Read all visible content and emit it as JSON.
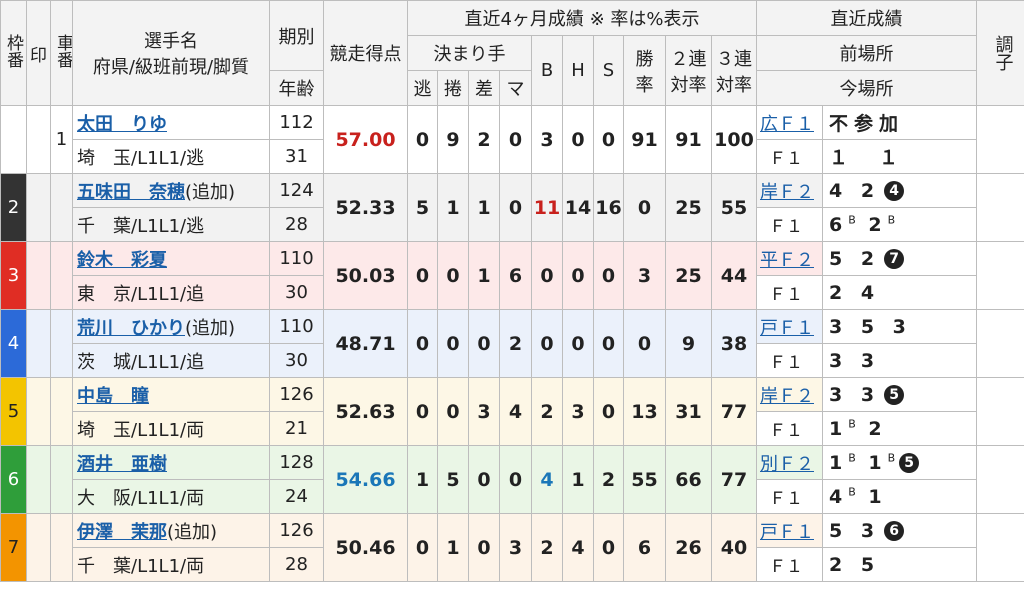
{
  "header": {
    "waku": "枠番",
    "in": "印",
    "sha": "車番",
    "name_top": "選手名",
    "name_bottom": "府県/級班前現/脚質",
    "kibetsu": "期別",
    "nenrei": "年齢",
    "score": "競走得点",
    "recent_group": "直近4ヶ月成績 ※ 率は%表示",
    "kimarite": "決まり手",
    "nige": "逃",
    "makuri": "捲",
    "sashi": "差",
    "ma": "マ",
    "b": "B",
    "h": "H",
    "s": "S",
    "win_top": "勝",
    "win_bottom": "率",
    "ren2_top": "２連",
    "ren2_bottom": "対率",
    "ren3_top": "３連",
    "ren3_bottom": "対率",
    "recent_results": "直近成績",
    "prev_venue": "前場所",
    "cur_venue": "今場所",
    "condition": "調子"
  },
  "riders": [
    {
      "waku": "",
      "sha": "1",
      "name": "太田　りゆ",
      "suffix": "",
      "pref": "埼　玉/L1L1/逃",
      "ki": "112",
      "age": "31",
      "score": "57.00",
      "score_color": "red",
      "nige": "0",
      "makuri": "9",
      "sashi": "2",
      "ma": "0",
      "b": "3",
      "h": "0",
      "s": "0",
      "win": "91",
      "ren2": "91",
      "ren3": "100",
      "prev": "広Ｆ１",
      "prev_res": "不参加",
      "cur": "Ｆ１",
      "cur_res": "１　１"
    },
    {
      "waku": "2",
      "sha": "",
      "name": "五味田　奈穂",
      "suffix": "(追加)",
      "pref": "千　葉/L1L1/逃",
      "ki": "124",
      "age": "28",
      "score": "52.33",
      "score_color": "",
      "nige": "5",
      "makuri": "1",
      "sashi": "1",
      "ma": "0",
      "b": "11",
      "h": "14",
      "s": "16",
      "win": "0",
      "ren2": "25",
      "ren3": "55",
      "prev": "岸Ｆ２",
      "prev_res": "4 2",
      "prev_circ": "4",
      "cur": "Ｆ１",
      "cur_res": "6 2",
      "cur_sup": "B"
    },
    {
      "waku": "3",
      "sha": "",
      "name": "鈴木　彩夏",
      "suffix": "",
      "pref": "東　京/L1L1/追",
      "ki": "110",
      "age": "30",
      "score": "50.03",
      "score_color": "",
      "nige": "0",
      "makuri": "0",
      "sashi": "1",
      "ma": "6",
      "b": "0",
      "h": "0",
      "s": "0",
      "win": "3",
      "ren2": "25",
      "ren3": "44",
      "prev": "平Ｆ２",
      "prev_res": "5 2",
      "prev_circ": "7",
      "cur": "Ｆ１",
      "cur_res": "2 4"
    },
    {
      "waku": "4",
      "sha": "",
      "name": "荒川　ひかり",
      "suffix": "(追加)",
      "pref": "茨　城/L1L1/追",
      "ki": "110",
      "age": "30",
      "score": "48.71",
      "score_color": "",
      "nige": "0",
      "makuri": "0",
      "sashi": "0",
      "ma": "2",
      "b": "0",
      "h": "0",
      "s": "0",
      "win": "0",
      "ren2": "9",
      "ren3": "38",
      "prev": "戸Ｆ１",
      "prev_res": "3 5 3",
      "cur": "Ｆ１",
      "cur_res": "3 3"
    },
    {
      "waku": "5",
      "sha": "",
      "name": "中島　瞳",
      "suffix": "",
      "pref": "埼　玉/L1L1/両",
      "ki": "126",
      "age": "21",
      "score": "52.63",
      "score_color": "",
      "nige": "0",
      "makuri": "0",
      "sashi": "3",
      "ma": "4",
      "b": "2",
      "h": "3",
      "s": "0",
      "win": "13",
      "ren2": "31",
      "ren3": "77",
      "prev": "岸Ｆ２",
      "prev_res": "3 3",
      "prev_circ": "5",
      "cur": "Ｆ１",
      "cur_res": "1 2",
      "cur_sup": "B"
    },
    {
      "waku": "6",
      "sha": "",
      "name": "酒井　亜樹",
      "suffix": "",
      "pref": "大　阪/L1L1/両",
      "ki": "128",
      "age": "24",
      "score": "54.66",
      "score_color": "blue",
      "nige": "1",
      "makuri": "5",
      "sashi": "0",
      "ma": "0",
      "b": "4",
      "h": "1",
      "s": "2",
      "win": "55",
      "ren2": "66",
      "ren3": "77",
      "prev": "別Ｆ２",
      "prev_res": "1 1",
      "prev_circ": "5",
      "cur": "Ｆ１",
      "cur_res": "4 1",
      "cur_sup": "B"
    },
    {
      "waku": "7",
      "sha": "",
      "name": "伊澤　茉那",
      "suffix": "(追加)",
      "pref": "千　葉/L1L1/両",
      "ki": "126",
      "age": "28",
      "score": "50.46",
      "score_color": "",
      "nige": "0",
      "makuri": "1",
      "sashi": "0",
      "ma": "3",
      "b": "2",
      "h": "4",
      "s": "0",
      "win": "6",
      "ren2": "26",
      "ren3": "40",
      "prev": "戸Ｆ１",
      "prev_res": "5 3",
      "prev_circ": "6",
      "cur": "Ｆ１",
      "cur_res": "2 5"
    }
  ],
  "colors": {
    "link": "#1a5fa8",
    "score_red": "#c8211d",
    "score_blue": "#1b77b8"
  }
}
